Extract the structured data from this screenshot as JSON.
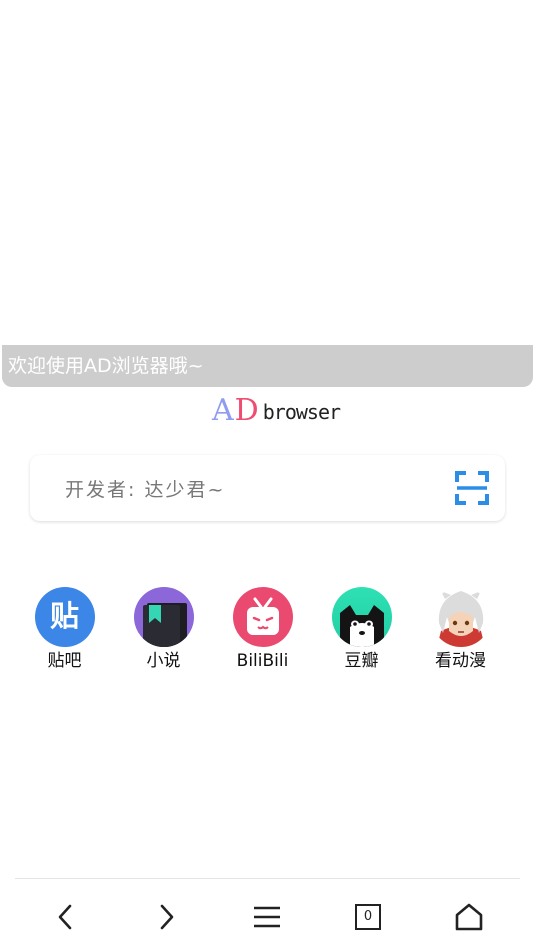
{
  "welcome": {
    "text": "欢迎使用AD浏览器哦~"
  },
  "logo": {
    "ad_a": "A",
    "ad_d": "D",
    "browser": "browser"
  },
  "search": {
    "text": "开发者: 达少君~",
    "icon": "scan-icon"
  },
  "shortcuts": [
    {
      "label": "贴吧",
      "icon": "tieba-icon",
      "icon_text": "贴",
      "color": "#3b86e6"
    },
    {
      "label": "小说",
      "icon": "novel-icon",
      "color": "#8b67d9"
    },
    {
      "label": "BiliBili",
      "icon": "bilibili-icon",
      "color": "#ea4a70"
    },
    {
      "label": "豆瓣",
      "icon": "douban-icon",
      "color": "#22d8ae"
    },
    {
      "label": "看动漫",
      "icon": "anime-icon",
      "color": "#cc3a33"
    }
  ],
  "bottom_nav": {
    "back": "back-icon",
    "forward": "forward-icon",
    "menu": "menu-icon",
    "tab_count": "0",
    "home": "home-icon"
  },
  "colors": {
    "accent": "#2b8de8",
    "welcome_bar": "#cdcdcd",
    "logo_a": "#8f9cf0",
    "logo_d": "#ee4c70"
  }
}
